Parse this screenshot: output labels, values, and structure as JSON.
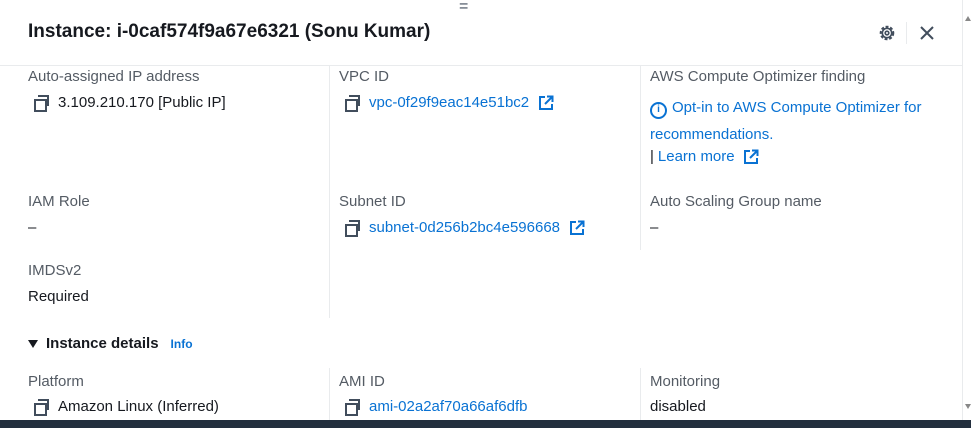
{
  "panel": {
    "title": "Instance: i-0caf574f9a67e6321 (Sonu Kumar)",
    "drag_handle": "="
  },
  "fields": {
    "auto_ip": {
      "label": "Auto-assigned IP address",
      "value": "3.109.210.170 [Public IP]"
    },
    "vpc": {
      "label": "VPC ID",
      "value": "vpc-0f29f9eac14e51bc2"
    },
    "optimizer": {
      "label": "AWS Compute Optimizer finding",
      "link_text": "Opt-in to AWS Compute Optimizer for recommendations.",
      "learn_prefix": "|",
      "learn_more": "Learn more"
    },
    "iam": {
      "label": "IAM Role",
      "value": "–"
    },
    "subnet": {
      "label": "Subnet ID",
      "value": "subnet-0d256b2bc4e596668"
    },
    "asg": {
      "label": "Auto Scaling Group name",
      "value": "–"
    },
    "imds": {
      "label": "IMDSv2",
      "value": "Required"
    }
  },
  "instance_details": {
    "title": "Instance details",
    "info": "Info",
    "platform": {
      "label": "Platform",
      "value": "Amazon Linux (Inferred)"
    },
    "ami": {
      "label": "AMI ID",
      "value": "ami-02a2af70a66af6dfb"
    },
    "monitoring": {
      "label": "Monitoring",
      "value": "disabled"
    }
  },
  "colors": {
    "link": "#0972d3",
    "text": "#16191f",
    "label": "#545b64",
    "bottom_bar": "#232f3e"
  },
  "icons": [
    "settings-icon",
    "close-icon",
    "copy-icon",
    "external-link-icon",
    "info-icon",
    "caret-down-icon"
  ]
}
